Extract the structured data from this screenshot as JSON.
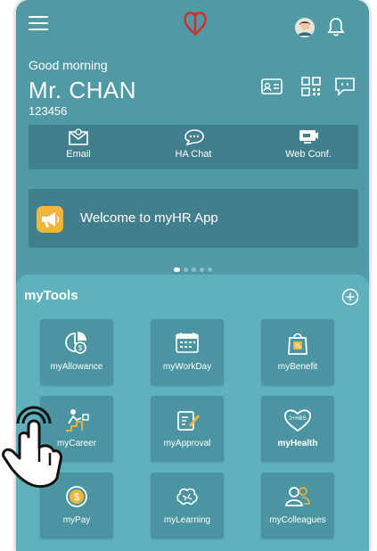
{
  "header": {
    "menu_icon": "hamburger-icon",
    "logo_icon": "hospital-authority-logo",
    "avatar_icon": "user-avatar",
    "bell_icon": "bell-icon"
  },
  "profile": {
    "greeting": "Good morning",
    "name": "Mr. CHAN",
    "staff_id": "123456",
    "icons": [
      "id-card-icon",
      "qr-code-icon",
      "message-icon"
    ]
  },
  "quick_actions": [
    {
      "label": "Email",
      "icon": "email-icon"
    },
    {
      "label": "HA Chat",
      "icon": "chat-icon"
    },
    {
      "label": "Web Conf.",
      "icon": "web-conference-icon"
    }
  ],
  "banner": {
    "text": "Welcome to myHR App",
    "icon": "megaphone-icon"
  },
  "carousel": {
    "count": 5,
    "active": 1
  },
  "tools": {
    "title": "myTools",
    "add_icon": "plus-circle-icon",
    "items": [
      {
        "label": "myAllowance",
        "icon": "allowance-icon"
      },
      {
        "label": "myWorkDay",
        "icon": "calendar-icon"
      },
      {
        "label": "myBenefit",
        "icon": "benefit-icon"
      },
      {
        "label": "myCareer",
        "icon": "career-icon"
      },
      {
        "label": "myApproval",
        "icon": "approval-icon"
      },
      {
        "label": "myHealth",
        "icon": "health-heart-icon",
        "heart_text": "2+HBS"
      },
      {
        "label": "myPay",
        "icon": "pay-icon"
      },
      {
        "label": "myLearning",
        "icon": "learning-brain-icon"
      },
      {
        "label": "myColleagues",
        "icon": "colleagues-icon"
      }
    ]
  },
  "overlay": {
    "icon": "tap-hand-icon"
  },
  "colors": {
    "background": "#4f9aa4",
    "panel": "#427f8c",
    "tools_background": "#5fb1bc",
    "tile": "#4a95a1",
    "accent_yellow": "#f3b63a",
    "logo_red": "#d2302e"
  }
}
